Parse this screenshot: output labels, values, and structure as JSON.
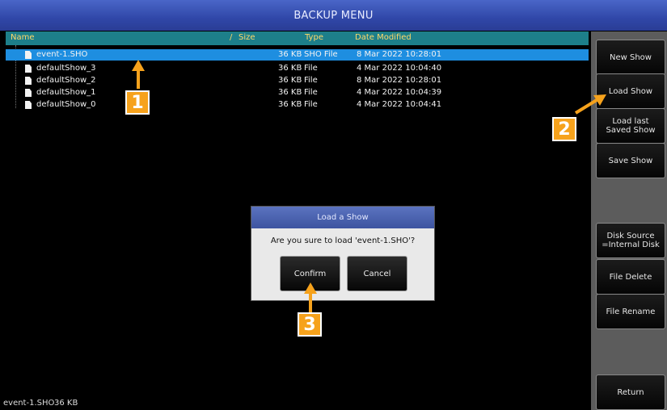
{
  "title": "BACKUP MENU",
  "columns": {
    "name": "Name",
    "sort": "/",
    "size": "Size",
    "type": "Type",
    "date": "Date Modified"
  },
  "files": [
    {
      "name": "event-1.SHO",
      "size": "36 KB",
      "type": "SHO File",
      "date": "8 Mar 2022 10:28:01",
      "selected": true
    },
    {
      "name": "defaultShow_3",
      "size": "36 KB",
      "type": "File",
      "date": "4 Mar 2022 10:04:40"
    },
    {
      "name": "defaultShow_2",
      "size": "36 KB",
      "type": "File",
      "date": "8 Mar 2022 10:28:01"
    },
    {
      "name": "defaultShow_1",
      "size": "36 KB",
      "type": "File",
      "date": "4 Mar 2022 10:04:39"
    },
    {
      "name": "defaultShow_0",
      "size": "36 KB",
      "type": "File",
      "date": "4 Mar 2022 10:04:41"
    }
  ],
  "sidebar": {
    "new_show": "New Show",
    "load_show": "Load Show",
    "load_last": "Load last\nSaved Show",
    "save_show": "Save Show",
    "disk_source": "Disk Source\n=Internal Disk",
    "file_delete": "File Delete",
    "file_rename": "File Rename",
    "return": "Return"
  },
  "dialog": {
    "title": "Load a Show",
    "message": "Are you sure to load  'event-1.SHO'?",
    "confirm": "Confirm",
    "cancel": "Cancel"
  },
  "status": {
    "file": "event-1.SHO",
    "size": "36 KB"
  },
  "annotations": {
    "step1": "1",
    "step2": "2",
    "step3": "3"
  },
  "colors": {
    "title_bar": "#3047a8",
    "header": "#1d7f8a",
    "selection": "#1e8ee0",
    "badge": "#f6a21c",
    "sidebar": "#5c5c5c"
  }
}
